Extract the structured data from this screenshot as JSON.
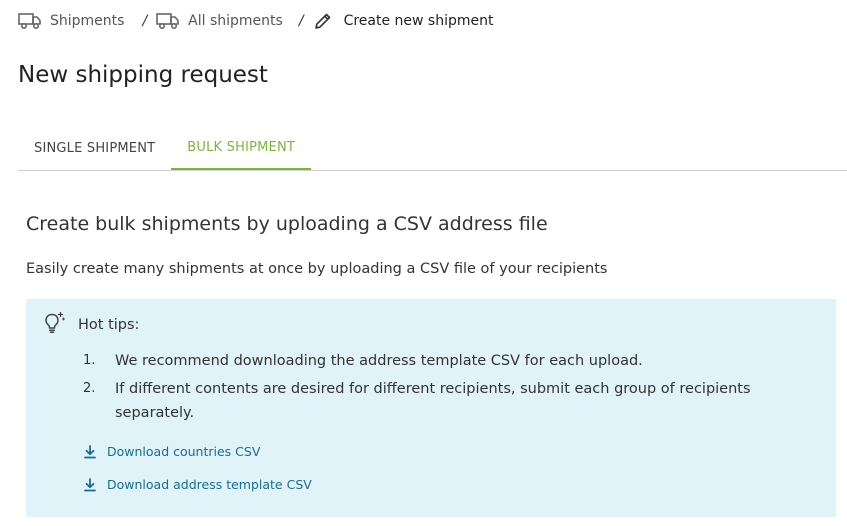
{
  "breadcrumb": {
    "items": [
      {
        "label": "Shipments",
        "icon": "truck-icon"
      },
      {
        "label": "All shipments",
        "icon": "truck-icon"
      },
      {
        "label": "Create new shipment",
        "icon": "pencil-icon"
      }
    ],
    "separator": "/"
  },
  "page": {
    "title": "New shipping request"
  },
  "tabs": [
    {
      "label": "SINGLE SHIPMENT",
      "active": false
    },
    {
      "label": "BULK SHIPMENT",
      "active": true
    }
  ],
  "bulk": {
    "heading": "Create bulk shipments by uploading a CSV address file",
    "description": "Easily create many shipments at once by uploading a CSV file of your recipients",
    "tips": {
      "icon": "lightbulb-icon",
      "title": "Hot tips:",
      "items": [
        {
          "number": "1.",
          "text": "We recommend downloading the address template CSV for each upload."
        },
        {
          "number": "2.",
          "text": "If different contents are desired for different recipients, submit each group of recipients separately."
        }
      ],
      "links": [
        {
          "label": "Download countries CSV",
          "icon": "download-icon"
        },
        {
          "label": "Download address template CSV",
          "icon": "download-icon"
        }
      ]
    }
  },
  "colors": {
    "accent": "#7cb342",
    "link": "#1a6c8f",
    "tips_background": "#dff3f9"
  }
}
